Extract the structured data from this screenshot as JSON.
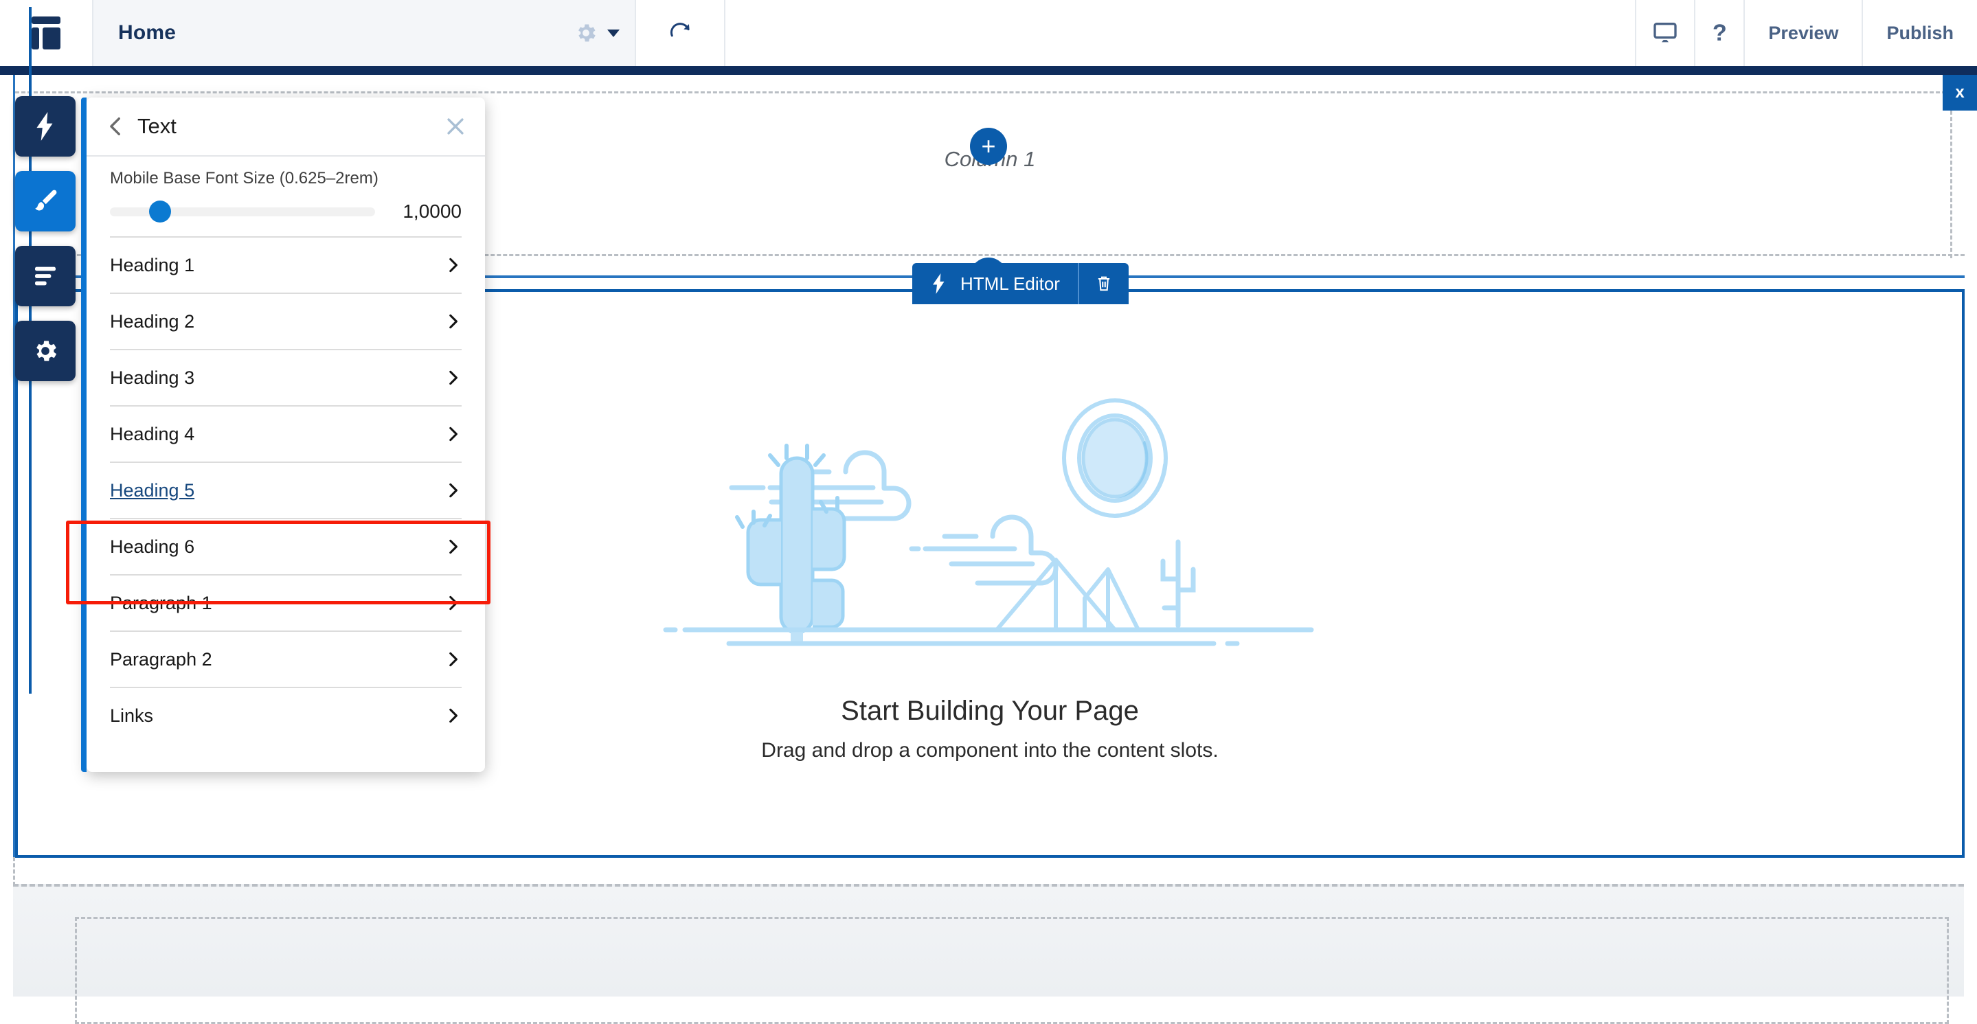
{
  "topbar": {
    "logo_name": "page-builder-logo",
    "page_title": "Home",
    "gear_icon": "gear-icon",
    "caret_icon": "chevron-down-icon",
    "refresh_icon": "refresh-icon",
    "desktop_icon": "desktop-preview-icon",
    "help_label": "?",
    "preview_label": "Preview",
    "publish_label": "Publish"
  },
  "sidebar": {
    "items": [
      {
        "name": "components-button",
        "icon": "lightning-bolt-icon",
        "active": false
      },
      {
        "name": "theme-button",
        "icon": "paintbrush-icon",
        "active": true
      },
      {
        "name": "page-structure-button",
        "icon": "list-lines-icon",
        "active": false
      },
      {
        "name": "settings-button",
        "icon": "gear-icon",
        "active": false
      }
    ]
  },
  "panel": {
    "back_icon": "chevron-left-icon",
    "title": "Text",
    "close_icon": "close-icon",
    "slider": {
      "label": "Mobile Base Font Size (0.625–2rem)",
      "value": "1,0000",
      "fill_percent": 19
    },
    "items": [
      {
        "label": "Heading 1",
        "highlighted": false
      },
      {
        "label": "Heading 2",
        "highlighted": false
      },
      {
        "label": "Heading 3",
        "highlighted": false
      },
      {
        "label": "Heading 4",
        "highlighted": false
      },
      {
        "label": "Heading 5",
        "highlighted": true
      },
      {
        "label": "Heading 6",
        "highlighted": false
      },
      {
        "label": "Paragraph 1",
        "highlighted": false
      },
      {
        "label": "Paragraph 2",
        "highlighted": false
      },
      {
        "label": "Links",
        "highlighted": false
      }
    ],
    "chevron_icon": "chevron-right-icon"
  },
  "canvas": {
    "add_section_label": "+",
    "column_label": "Column 1",
    "close_label": "x",
    "toolbar": {
      "bolt_icon": "lightning-bolt-icon",
      "label": "HTML Editor",
      "delete_icon": "trash-icon"
    },
    "empty_state": {
      "illustration": "desert-cactus-illustration",
      "title": "Start Building Your Page",
      "subtitle": "Drag and drop a component into the content slots."
    }
  },
  "colors": {
    "brand_dark": "#16325c",
    "brand_blue": "#0b5cab",
    "accent_blue": "#0b74d1",
    "highlight_red": "#f61c08",
    "illustration_blue": "#b3ddf7"
  }
}
